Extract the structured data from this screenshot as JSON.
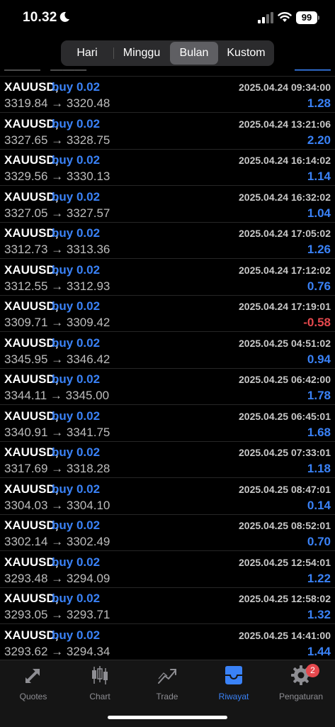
{
  "status_bar": {
    "time": "10.32",
    "battery": "99"
  },
  "period_tabs": [
    {
      "label": "Hari",
      "active": false
    },
    {
      "label": "Minggu",
      "active": false
    },
    {
      "label": "Bulan",
      "active": true
    },
    {
      "label": "Kustom",
      "active": false
    }
  ],
  "trades": [
    {
      "symbol": "XAUUSD,",
      "side": "buy 0.02",
      "datetime": "2025.04.24 09:34:00",
      "prices": "3319.84 → 3320.48",
      "profit": "1.28"
    },
    {
      "symbol": "XAUUSD,",
      "side": "buy 0.02",
      "datetime": "2025.04.24 13:21:06",
      "prices": "3327.65 → 3328.75",
      "profit": "2.20"
    },
    {
      "symbol": "XAUUSD,",
      "side": "buy 0.02",
      "datetime": "2025.04.24 16:14:02",
      "prices": "3329.56 → 3330.13",
      "profit": "1.14"
    },
    {
      "symbol": "XAUUSD,",
      "side": "buy 0.02",
      "datetime": "2025.04.24 16:32:02",
      "prices": "3327.05 → 3327.57",
      "profit": "1.04"
    },
    {
      "symbol": "XAUUSD,",
      "side": "buy 0.02",
      "datetime": "2025.04.24 17:05:02",
      "prices": "3312.73 → 3313.36",
      "profit": "1.26"
    },
    {
      "symbol": "XAUUSD,",
      "side": "buy 0.02",
      "datetime": "2025.04.24 17:12:02",
      "prices": "3312.55 → 3312.93",
      "profit": "0.76"
    },
    {
      "symbol": "XAUUSD,",
      "side": "buy 0.02",
      "datetime": "2025.04.24 17:19:01",
      "prices": "3309.71 → 3309.42",
      "profit": "-0.58"
    },
    {
      "symbol": "XAUUSD,",
      "side": "buy 0.02",
      "datetime": "2025.04.25 04:51:02",
      "prices": "3345.95 → 3346.42",
      "profit": "0.94"
    },
    {
      "symbol": "XAUUSD,",
      "side": "buy 0.02",
      "datetime": "2025.04.25 06:42:00",
      "prices": "3344.11 → 3345.00",
      "profit": "1.78"
    },
    {
      "symbol": "XAUUSD,",
      "side": "buy 0.02",
      "datetime": "2025.04.25 06:45:01",
      "prices": "3340.91 → 3341.75",
      "profit": "1.68"
    },
    {
      "symbol": "XAUUSD,",
      "side": "buy 0.02",
      "datetime": "2025.04.25 07:33:01",
      "prices": "3317.69 → 3318.28",
      "profit": "1.18"
    },
    {
      "symbol": "XAUUSD,",
      "side": "buy 0.02",
      "datetime": "2025.04.25 08:47:01",
      "prices": "3304.03 → 3304.10",
      "profit": "0.14"
    },
    {
      "symbol": "XAUUSD,",
      "side": "buy 0.02",
      "datetime": "2025.04.25 08:52:01",
      "prices": "3302.14 → 3302.49",
      "profit": "0.70"
    },
    {
      "symbol": "XAUUSD,",
      "side": "buy 0.02",
      "datetime": "2025.04.25 12:54:01",
      "prices": "3293.48 → 3294.09",
      "profit": "1.22"
    },
    {
      "symbol": "XAUUSD,",
      "side": "buy 0.02",
      "datetime": "2025.04.25 12:58:02",
      "prices": "3293.05 → 3293.71",
      "profit": "1.32"
    },
    {
      "symbol": "XAUUSD,",
      "side": "buy 0.02",
      "datetime": "2025.04.25 14:41:00",
      "prices": "3293.62 → 3294.34",
      "profit": "1.44"
    }
  ],
  "tab_bar": [
    {
      "label": "Quotes",
      "icon": "quotes-icon",
      "active": false
    },
    {
      "label": "Chart",
      "icon": "chart-icon",
      "active": false
    },
    {
      "label": "Trade",
      "icon": "trade-icon",
      "active": false
    },
    {
      "label": "Riwayat",
      "icon": "history-icon",
      "active": true
    },
    {
      "label": "Pengaturan",
      "icon": "gear-icon",
      "active": false,
      "badge": "2"
    }
  ],
  "colors": {
    "profit_positive": "#3a82f7",
    "profit_negative": "#e5484d",
    "accent": "#3a82f7",
    "background": "#000000"
  }
}
